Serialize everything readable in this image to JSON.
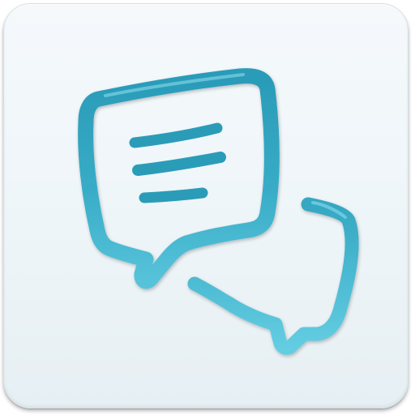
{
  "app_icon": {
    "icon": "speech-bubbles-chat-icon",
    "colors": {
      "background_top": "#f5f9fc",
      "background_bottom": "#e6eff3",
      "bubble_light": "#5fc6dc",
      "bubble_mid": "#39aac6",
      "bubble_dark": "#1f8aa6",
      "text_lines": "#2b9cb8"
    }
  }
}
